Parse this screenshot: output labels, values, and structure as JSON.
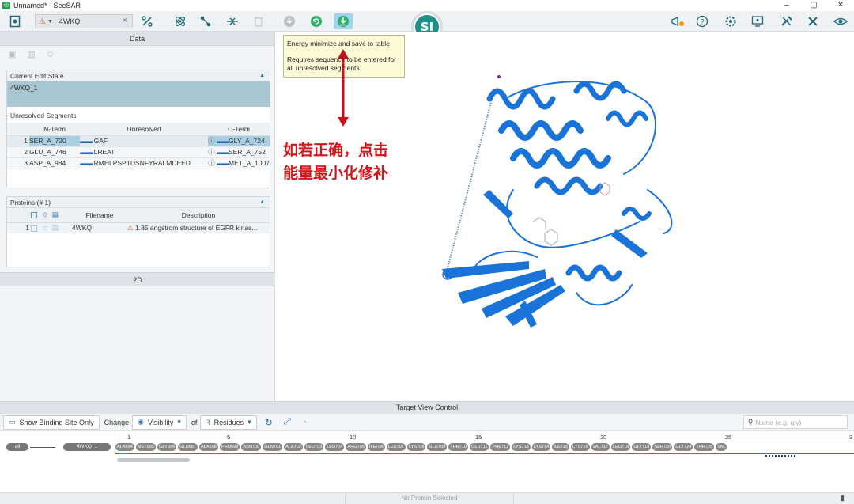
{
  "window": {
    "title": "Unnamed* - SeeSAR",
    "controls": [
      "–",
      "▢",
      "✕"
    ]
  },
  "toolbar": {
    "protein_name": "4WKQ",
    "clear": "×"
  },
  "tooltip": {
    "line1": "Energy minimize and save to table",
    "line2": "Requires sequence to be entered for all unresolved segments."
  },
  "logo": {
    "text": "SI"
  },
  "annotation": {
    "line1": "如若正确，点击",
    "line2": "能量最小化修补",
    "color": "#d4161b"
  },
  "data_panel": {
    "title": "Data",
    "current_edit_state": {
      "title": "Current Edit State",
      "value": "4WKQ_1"
    },
    "unresolved_segments": {
      "title": "Unresolved Segments",
      "headers": [
        "N-Term",
        "Unresolved",
        "C-Term"
      ],
      "rows": [
        {
          "idx": "1",
          "nterm": "SER_A_720",
          "unresolved": "GAF",
          "cterm": "GLY_A_724"
        },
        {
          "idx": "2",
          "nterm": "GLU_A_746",
          "unresolved": "LREAT",
          "cterm": "SER_A_752"
        },
        {
          "idx": "3",
          "nterm": "ASP_A_984",
          "unresolved": "RMHLPSPTDSNFYRALMDEED",
          "cterm": "MET_A_1007"
        }
      ]
    },
    "proteins": {
      "title": "Proteins (# 1)",
      "headers": [
        "Filename",
        "Description"
      ],
      "rows": [
        {
          "idx": "1",
          "filename": "4WKQ",
          "description": "1.85 angstrom structure of EGFR kinas..."
        }
      ]
    },
    "panel_2d": "2D"
  },
  "target_view": {
    "title": "Target View Control",
    "show_binding_site": "Show Binding Site Only",
    "change": "Change",
    "visibility": "Visibility",
    "of": "of",
    "residues": "Residues",
    "search_placeholder": "Name (e.g. gly)",
    "all_chip": "all",
    "chain_chip": "4WKQ_1",
    "ruler": [
      "1",
      "5",
      "10",
      "15",
      "20",
      "25",
      "3"
    ],
    "residues_list": [
      "ALA694",
      "MET695",
      "GLY696",
      "GLU697",
      "ALA698",
      "PRO699",
      "ASN700",
      "GLN701",
      "ALA702",
      "LEU703",
      "LEU704",
      "ARG705",
      "ILE706",
      "LEU707",
      "LYS708",
      "GLU709",
      "THR710",
      "GLU711",
      "PHE712",
      "LYS713",
      "LYS714",
      "ILE715",
      "LYS716",
      "VAL717",
      "LEU718",
      "GLY719",
      "SER720",
      "GLY724",
      "THR725",
      "VAL"
    ]
  },
  "status": {
    "center": "No Protein Selected"
  },
  "colors": {
    "protein_ribbon": "#1a73d9",
    "toolbar_icon": "#1e6a7c",
    "selection": "#a9c7d3"
  }
}
